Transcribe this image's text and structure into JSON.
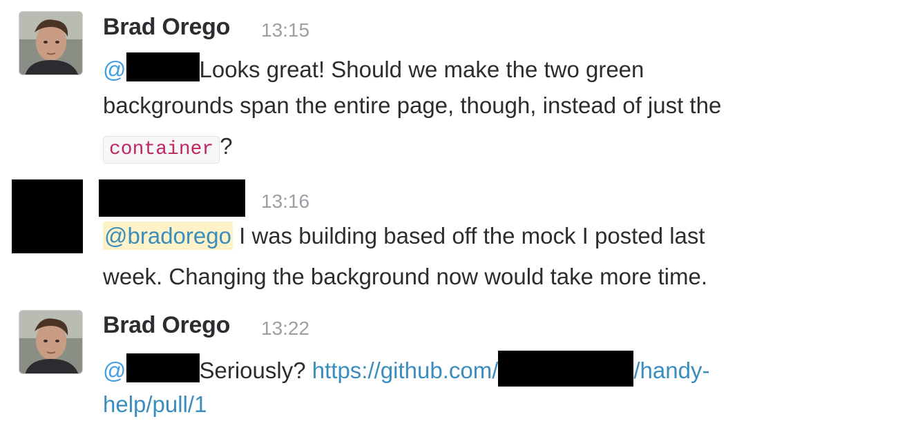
{
  "messages": [
    {
      "author": "Brad Orego",
      "time": "13:15",
      "lines": {
        "l1_at": "@",
        "l1_text": "Looks great! Should we make the two green",
        "l2_text": "backgrounds span the entire page, though, instead of just the",
        "l3_code": "container",
        "l3_after": "?"
      }
    },
    {
      "author": "",
      "time": "13:16",
      "lines": {
        "l1_mention": "@bradorego",
        "l1_text": " I was building based off the mock I posted last",
        "l2_text": "week. Changing the background now would take more time."
      }
    },
    {
      "author": "Brad Orego",
      "time": "13:22",
      "lines": {
        "l1_at": "@",
        "l1_text": "Seriously?",
        "l1_link_a": "https://github.com/",
        "l1_link_b": "/handy-",
        "l2_link": "help/pull/1"
      }
    }
  ],
  "colors": {
    "text": "#2c2d30",
    "timestamp": "#9e9ea6",
    "link": "#3b8dbd",
    "mention_highlight": "#fdf2c8",
    "code_text": "#c0275e",
    "redaction": "#000000"
  },
  "icons": {
    "avatar": "user-photo-avatar"
  }
}
